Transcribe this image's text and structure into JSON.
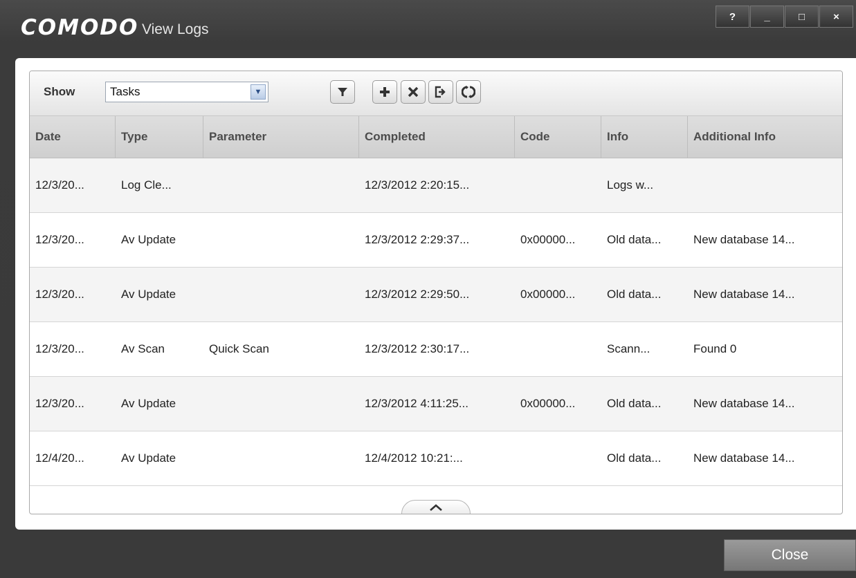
{
  "window": {
    "logo": "COMODO",
    "title": "View Logs",
    "controls": [
      "?",
      "_",
      "□",
      "×"
    ]
  },
  "toolbar": {
    "show_label": "Show",
    "show_value": "Tasks",
    "buttons": [
      "filter-icon",
      "add-icon",
      "delete-icon",
      "export-icon",
      "refresh-icon"
    ]
  },
  "table": {
    "columns": [
      "Date",
      "Type",
      "Parameter",
      "Completed",
      "Code",
      "Info",
      "Additional Info"
    ],
    "rows": [
      [
        "12/3/20...",
        "Log Cle...",
        "",
        "12/3/2012 2:20:15...",
        "",
        "Logs w...",
        ""
      ],
      [
        "12/3/20...",
        "Av Update",
        "",
        "12/3/2012 2:29:37...",
        "0x00000...",
        "Old data...",
        "New database 14..."
      ],
      [
        "12/3/20...",
        "Av Update",
        "",
        "12/3/2012 2:29:50...",
        "0x00000...",
        "Old data...",
        "New database 14..."
      ],
      [
        "12/3/20...",
        "Av Scan",
        "Quick Scan",
        "12/3/2012 2:30:17...",
        "",
        "Scann...",
        "Found 0"
      ],
      [
        "12/3/20...",
        "Av Update",
        "",
        "12/3/2012 4:11:25...",
        "0x00000...",
        "Old data...",
        "New database 14..."
      ],
      [
        "12/4/20...",
        "Av Update",
        "",
        "12/4/2012 10:21:...",
        "",
        "Old data...",
        "New database 14..."
      ]
    ]
  },
  "footer": {
    "close_label": "Close"
  },
  "colors": {
    "background": "#3a3a3a",
    "panel": "#ffffff",
    "header": "#d6d6d6"
  }
}
